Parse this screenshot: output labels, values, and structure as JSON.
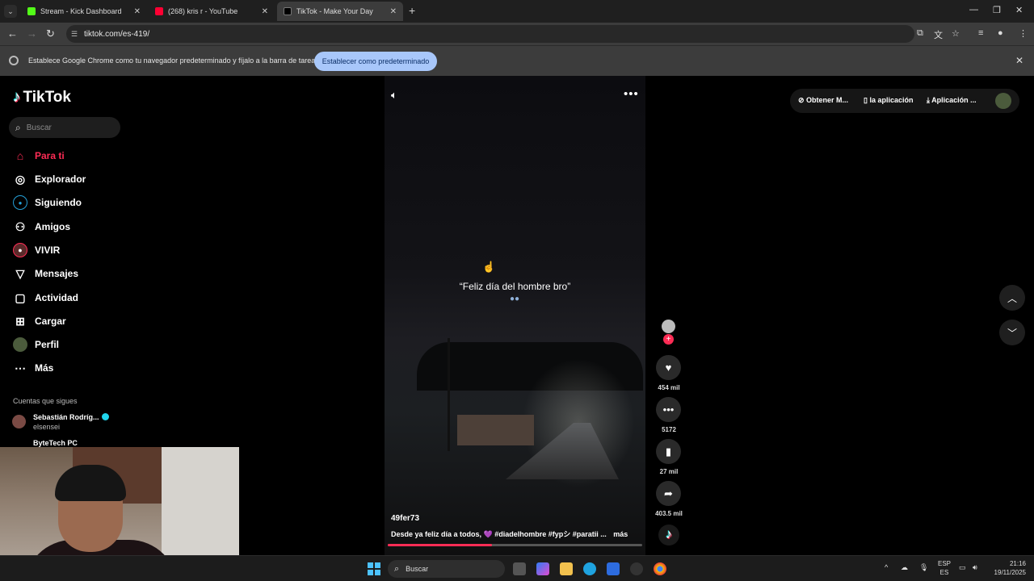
{
  "browser": {
    "tabs": [
      {
        "title": "Stream - Kick Dashboard",
        "favicon_color": "#53fc18"
      },
      {
        "title": "(268) kris r - YouTube",
        "favicon_color": "#ff0033"
      },
      {
        "title": "TikTok - Make Your Day",
        "favicon_color": "#000000"
      }
    ],
    "address": "tiktok.com/es-419/",
    "infobar": {
      "message": "Establece Google Chrome como tu navegador predeterminado y fíjalo a la barra de tareas",
      "button": "Establecer como predeterminado"
    }
  },
  "tiktok": {
    "logo": "TikTok",
    "search_placeholder": "Buscar",
    "nav": [
      {
        "label": "Para ti",
        "icon": "home-icon",
        "active": true
      },
      {
        "label": "Explorador",
        "icon": "compass-icon"
      },
      {
        "label": "Siguiendo",
        "icon": "following-icon"
      },
      {
        "label": "Amigos",
        "icon": "friends-icon"
      },
      {
        "label": "VIVIR",
        "icon": "live-icon"
      },
      {
        "label": "Mensajes",
        "icon": "messages-icon"
      },
      {
        "label": "Actividad",
        "icon": "activity-icon"
      },
      {
        "label": "Cargar",
        "icon": "upload-icon"
      },
      {
        "label": "Perfil",
        "icon": "profile-icon"
      },
      {
        "label": "Más",
        "icon": "more-icon"
      }
    ],
    "following_heading": "Cuentas que sigues",
    "following": [
      {
        "name": "Sebastián Rodríg...",
        "handle": "elsensei",
        "verified": true
      },
      {
        "name": "ByteTech PC",
        "handle": ""
      }
    ],
    "top_right": {
      "get_coins": "Obtener M...",
      "app": "la aplicación",
      "download_app": "Aplicación ..."
    },
    "video": {
      "caption": "“Feliz día del hombre bro”",
      "author": "49fer73",
      "description": "Desde ya feliz día a todos, 💜 #diadelhombre #fypシ #paratii ...",
      "more": "más",
      "progress": 0.41
    },
    "actions": {
      "likes": "454 mil",
      "comments": "5172",
      "saves": "27 mil",
      "shares": "403.5 mil"
    }
  },
  "taskbar": {
    "search_placeholder": "Buscar",
    "lang_top": "ESP",
    "lang_bottom": "ES",
    "time": "21:16",
    "date": "19/11/2025"
  }
}
